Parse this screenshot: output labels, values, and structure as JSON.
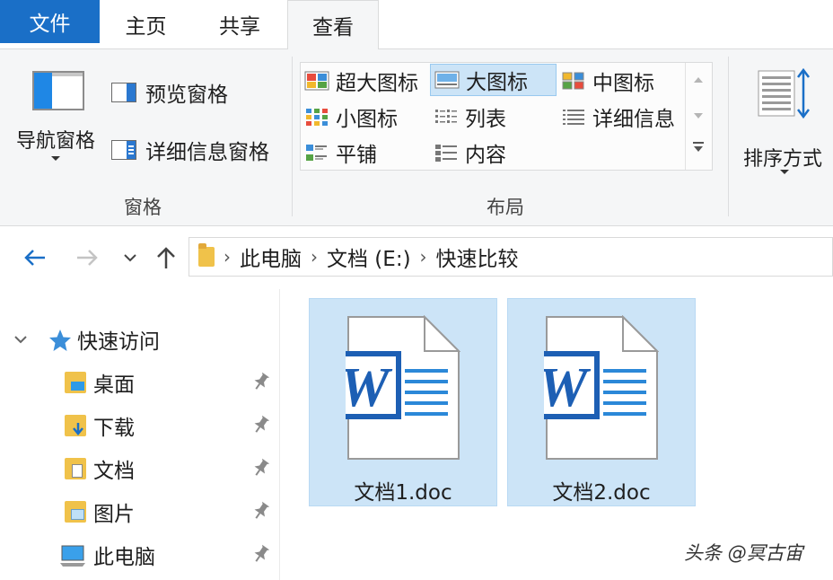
{
  "ribbon": {
    "tabs": [
      {
        "label": "文件"
      },
      {
        "label": "主页"
      },
      {
        "label": "共享"
      },
      {
        "label": "查看"
      }
    ],
    "panes_group": {
      "nav_pane_label": "导航窗格",
      "preview_pane_label": "预览窗格",
      "details_pane_label": "详细信息窗格",
      "group_label": "窗格"
    },
    "layout_group": {
      "items": [
        {
          "label": "超大图标"
        },
        {
          "label": "大图标"
        },
        {
          "label": "中图标"
        },
        {
          "label": "小图标"
        },
        {
          "label": "列表"
        },
        {
          "label": "详细信息"
        },
        {
          "label": "平铺"
        },
        {
          "label": "内容"
        }
      ],
      "selected": "大图标",
      "group_label": "布局"
    },
    "sort": {
      "label": "排序方式"
    }
  },
  "address": {
    "path": [
      "此电脑",
      "文档 (E:)",
      "快速比较"
    ]
  },
  "navigation": {
    "quick_access_label": "快速访问",
    "items": [
      {
        "label": "桌面",
        "icon": "desktop-folder-icon"
      },
      {
        "label": "下载",
        "icon": "downloads-folder-icon"
      },
      {
        "label": "文档",
        "icon": "documents-folder-icon"
      },
      {
        "label": "图片",
        "icon": "pictures-folder-icon"
      },
      {
        "label": "此电脑",
        "icon": "computer-icon"
      }
    ]
  },
  "files": [
    {
      "name": "文档1.doc",
      "icon": "word-document-icon"
    },
    {
      "name": "文档2.doc",
      "icon": "word-document-icon"
    }
  ],
  "watermark": "头条 @冥古宙",
  "colors": {
    "accent": "#1a6fc7",
    "selection": "#cce4f7",
    "word_blue": "#1d5fb4"
  }
}
